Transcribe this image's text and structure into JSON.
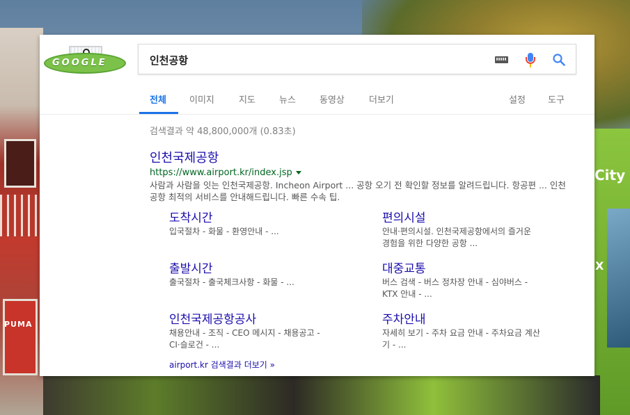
{
  "background": {
    "bus_text": "City",
    "bus_letter": "X",
    "sign_text": "PUMA"
  },
  "logo": {
    "text": "GOOGLE"
  },
  "search": {
    "query": "인천공항"
  },
  "tabs": {
    "items": [
      "전체",
      "이미지",
      "지도",
      "뉴스",
      "동영상",
      "더보기"
    ],
    "settings": "설정",
    "tools": "도구"
  },
  "stats": "검색결과 약 48,800,000개 (0.83초)",
  "result": {
    "title": "인천국제공항",
    "url": "https://www.airport.kr/index.jsp",
    "description": "사람과 사람을 잇는 인천국제공항. Incheon Airport ... 공항 오기 전 확인할 정보를 알려드립니다. 항공편 ... 인천공항 최적의 서비스를 안내해드립니다. 빠른 수속 팁."
  },
  "sitelinks": [
    {
      "title": "도착시간",
      "desc": "입국절차 - 화물 - 환영안내 - ..."
    },
    {
      "title": "편의시설",
      "desc": "안내·편의시설. 인천국제공항에서의 즐거운 경험을 위한 다양한 공항 ..."
    },
    {
      "title": "출발시간",
      "desc": "출국절차 - 출국체크사항 - 화물 - ..."
    },
    {
      "title": "대중교통",
      "desc": "버스 검색 - 버스 정차장 안내 - 심야버스 - KTX 안내 - ..."
    },
    {
      "title": "인천국제공항공사",
      "desc": "채용안내 - 조직 - CEO 메시지 - 채용공고 - CI·슬로건 - ..."
    },
    {
      "title": "주차안내",
      "desc": "자세히 보기 - 주차 요금 안내 - 주차요금 계산기 - ..."
    }
  ],
  "more_link": "airport.kr 검색결과 더보기 »",
  "colors": {
    "link": "#1a0dab",
    "url": "#006621",
    "active_tab": "#1a73e8"
  }
}
